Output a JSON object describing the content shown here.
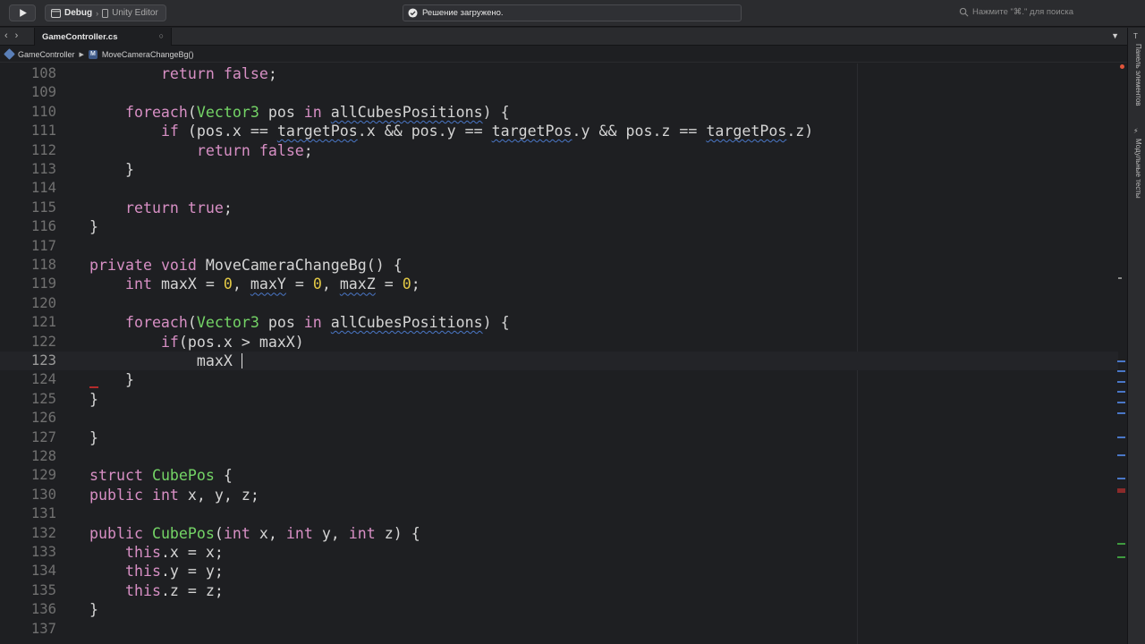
{
  "toolbar": {
    "configuration": "Debug",
    "target": "Unity Editor",
    "status": "Решение загружено.",
    "search_placeholder": "Нажмите \"⌘.\" для поиска"
  },
  "tabs": [
    {
      "label": "GameController.cs"
    }
  ],
  "breadcrumb": {
    "class_name": "GameController",
    "method_name": "MoveCameraChangeBg()"
  },
  "side_panel": {
    "toolbox_label": "Панель элементов",
    "unit_tests_label": "Модульные тесты"
  },
  "colors": {
    "keyword": "#d78fc4",
    "type": "#74d466",
    "number": "#e2c845",
    "text": "#d4d4d4",
    "background": "#1e1f22"
  },
  "code_lines": [
    {
      "n": "108",
      "text": "            return false;"
    },
    {
      "n": "109",
      "text": ""
    },
    {
      "n": "110",
      "text": "        foreach(Vector3 pos in allCubesPositions) {"
    },
    {
      "n": "111",
      "text": "            if (pos.x == targetPos.x && pos.y == targetPos.y && pos.z == targetPos.z)"
    },
    {
      "n": "112",
      "text": "                return false;"
    },
    {
      "n": "113",
      "text": "        }"
    },
    {
      "n": "114",
      "text": ""
    },
    {
      "n": "115",
      "text": "        return true;"
    },
    {
      "n": "116",
      "text": "    }"
    },
    {
      "n": "117",
      "text": ""
    },
    {
      "n": "118",
      "text": "    private void MoveCameraChangeBg() {"
    },
    {
      "n": "119",
      "text": "        int maxX = 0, maxY = 0, maxZ = 0;"
    },
    {
      "n": "120",
      "text": ""
    },
    {
      "n": "121",
      "text": "        foreach(Vector3 pos in allCubesPositions) {"
    },
    {
      "n": "122",
      "text": "            if(pos.x > maxX)"
    },
    {
      "n": "123",
      "text": "                maxX "
    },
    {
      "n": "124",
      "text": "        }"
    },
    {
      "n": "125",
      "text": "    }"
    },
    {
      "n": "126",
      "text": ""
    },
    {
      "n": "127",
      "text": "}"
    },
    {
      "n": "128",
      "text": ""
    },
    {
      "n": "129",
      "text": "struct CubePos {"
    },
    {
      "n": "130",
      "text": "    public int x, y, z;"
    },
    {
      "n": "131",
      "text": ""
    },
    {
      "n": "132",
      "text": "    public CubePos(int x, int y, int z) {"
    },
    {
      "n": "133",
      "text": "        this.x = x;"
    },
    {
      "n": "134",
      "text": "        this.y = y;"
    },
    {
      "n": "135",
      "text": "        this.z = z;"
    },
    {
      "n": "136",
      "text": "    }"
    },
    {
      "n": "137",
      "text": ""
    }
  ]
}
